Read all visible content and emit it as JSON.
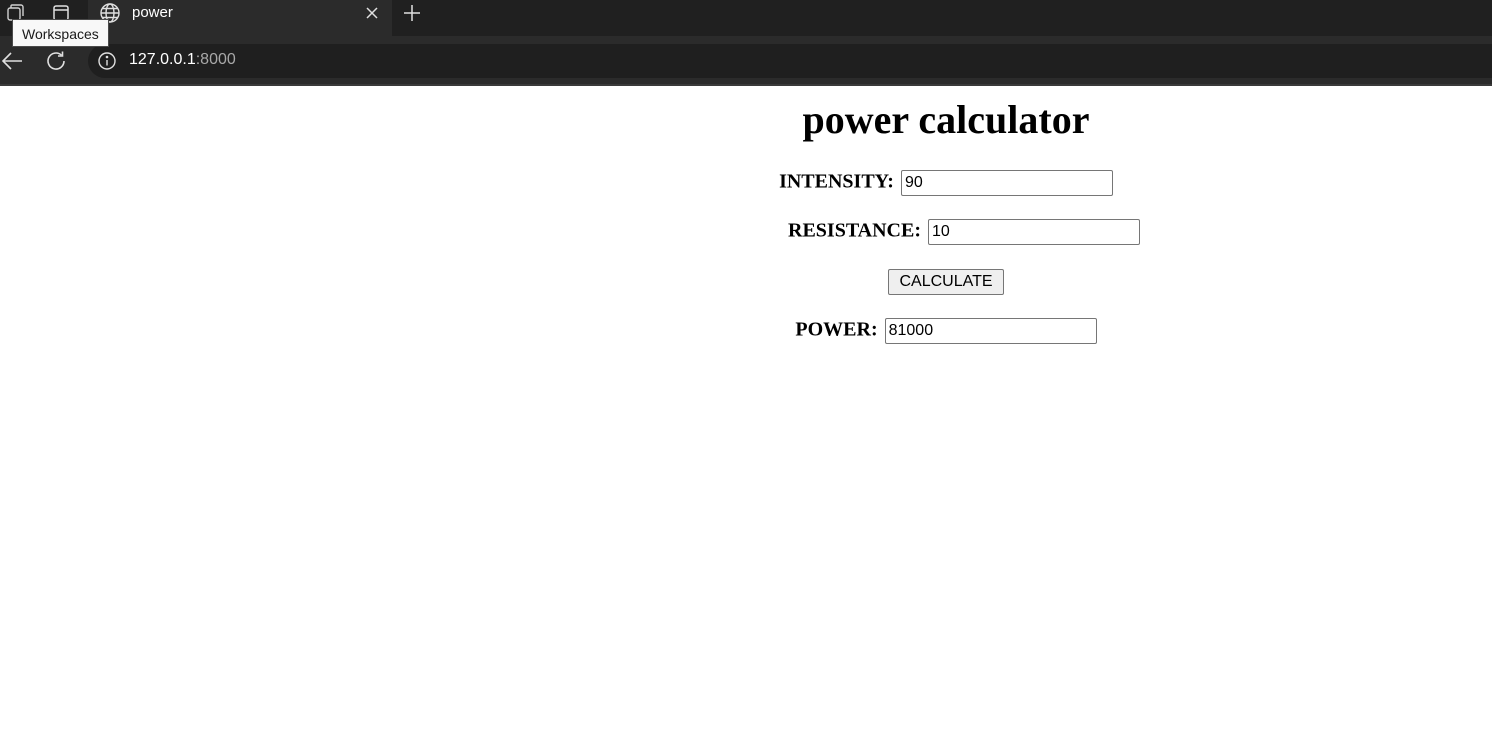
{
  "browser": {
    "tooltip": "Workspaces",
    "tab_title": "power",
    "url_host": "127.0.0.1",
    "url_port": ":8000"
  },
  "page": {
    "heading": "power calculator",
    "form": {
      "intensity_label": "INTENSITY:",
      "intensity_value": "90",
      "resistance_label": "RESISTANCE:",
      "resistance_value": "10",
      "calculate_label": "CALCULATE",
      "power_label": "POWER:",
      "power_value": "81000"
    }
  },
  "colors": {
    "tabbar_bg": "#202020",
    "toolbar_bg": "#2b2b2b",
    "page_bg": "#ffffff"
  },
  "icons": [
    "workspaces-icon",
    "tab-actions-icon",
    "globe-icon",
    "close-icon",
    "plus-icon",
    "back-arrow-icon",
    "reload-icon",
    "info-icon"
  ]
}
